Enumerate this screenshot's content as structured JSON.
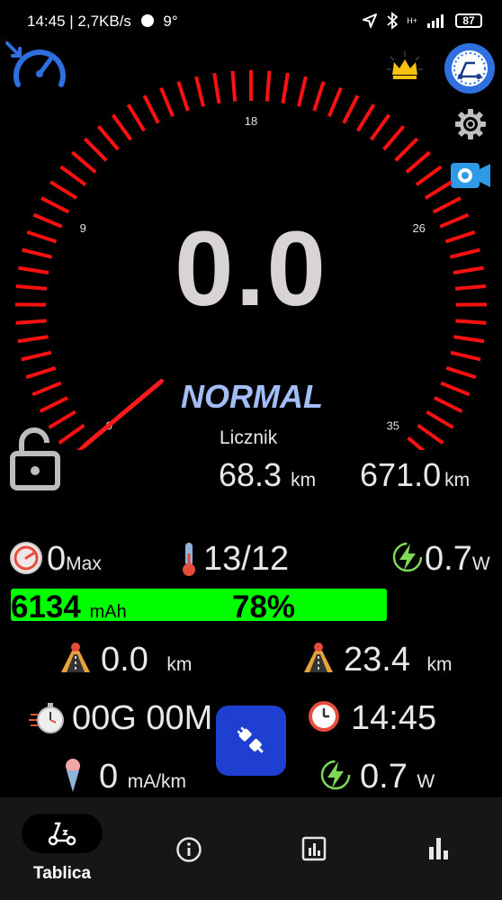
{
  "status_bar": {
    "time_info": "14:45 | 2,7KB/s",
    "temperature": "9°",
    "network": "H+",
    "battery_level": "87"
  },
  "gauge": {
    "tick_labels": [
      "0",
      "9",
      "18",
      "26",
      "35"
    ],
    "speed": "0.0",
    "speed_value": 0,
    "speed_max": 35,
    "mode": "NORMAL",
    "needle_color": "#ff1a1a",
    "tick_color": "#ff1010"
  },
  "odometer": {
    "label": "Licznik",
    "trip_value": "68.3",
    "trip_unit": "km",
    "total_value": "671.0",
    "total_unit": "km"
  },
  "stats_row": {
    "max_value": "0",
    "max_label": "Max",
    "temperature": "13/12",
    "power_value": "0.7",
    "power_unit": "W"
  },
  "battery": {
    "mah_value": "6134",
    "mah_unit": "mAh",
    "percent": "78%",
    "fill_fraction": 0.78,
    "color": "#00ff00"
  },
  "trip_row": {
    "distance_left_value": "0.0",
    "distance_left_unit": "km",
    "distance_right_value": "23.4",
    "distance_right_unit": "km"
  },
  "time_row": {
    "ride_time": "00G 00M",
    "clock": "14:45"
  },
  "consumption_row": {
    "consumption_value": "0",
    "consumption_unit": "mA/km",
    "power_value": "0.7",
    "power_unit": "W"
  },
  "bottom_nav": {
    "active_label": "Tablica",
    "items": [
      "scooter-icon",
      "info-icon",
      "report-icon",
      "bar-chart-icon"
    ]
  },
  "colors": {
    "accent_blue": "#2f6fe0",
    "fab_blue": "#1f3fd0",
    "mode_text": "#a3bdf8"
  }
}
